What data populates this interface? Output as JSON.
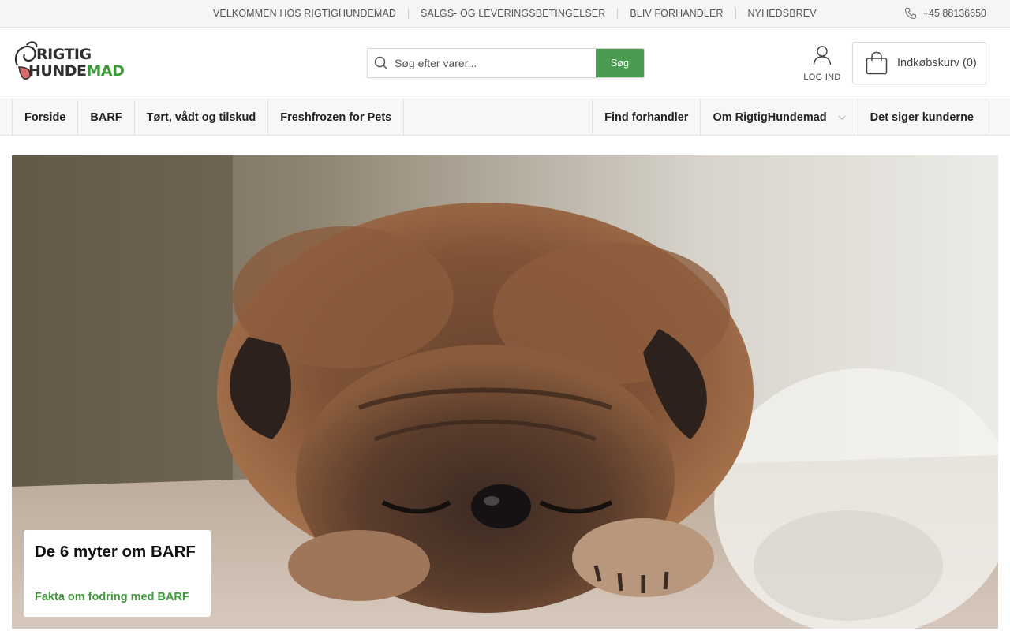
{
  "topbar": {
    "links": [
      "VELKOMMEN HOS RIGTIGHUNDEMAD",
      "SALGS- OG LEVERINGSBETINGELSER",
      "BLIV FORHANDLER",
      "NYHEDSBREV"
    ],
    "phone": "+45 88136650"
  },
  "header": {
    "logo_line1": "RIGTIG",
    "logo_line2_a": "HUNDE",
    "logo_line2_b": "MAD",
    "search_placeholder": "Søg efter varer...",
    "search_button": "Søg",
    "login_label": "LOG IND",
    "cart_label": "Indkøbskurv (0)"
  },
  "nav": {
    "left": [
      "Forside",
      "BARF",
      "Tørt, vådt og tilskud",
      "Freshfrozen for Pets"
    ],
    "right": [
      "Find forhandler",
      "Om RigtigHundemad",
      "Det siger kunderne"
    ]
  },
  "hero": {
    "title": "De 6 myter om BARF",
    "link": "Fakta om fodring med BARF"
  },
  "colors": {
    "accent_green": "#4a9a4f",
    "link_green": "#3f9a3b"
  }
}
